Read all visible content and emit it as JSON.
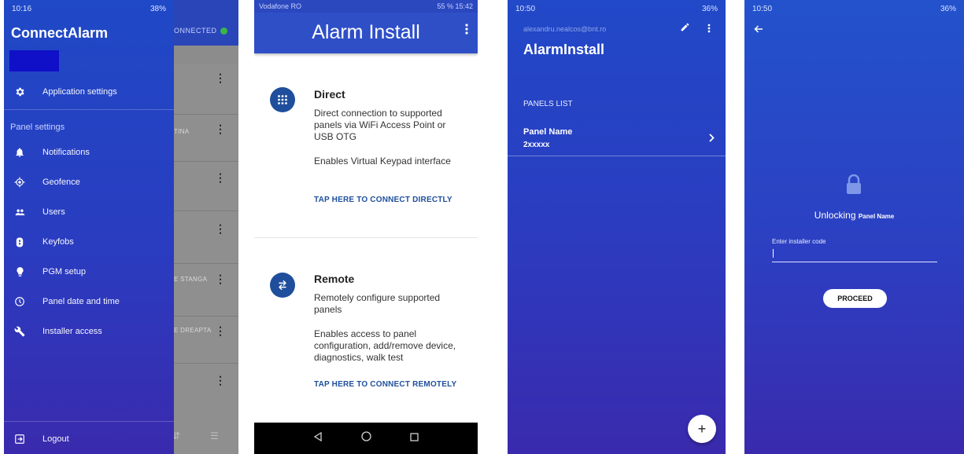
{
  "screen_drawer": {
    "status": {
      "time": "10:16",
      "right": "38%"
    },
    "background": {
      "connected": "ONNECTED",
      "row_texts": [
        "TINA",
        "E STANGA",
        "E DREAPTA"
      ]
    },
    "app_title": "ConnectAlarm",
    "account_color": "#1010c8",
    "menu_top": {
      "label": "Application settings",
      "icon": "gear-icon"
    },
    "section_title": "Panel settings",
    "items": [
      {
        "label": "Notifications",
        "icon": "bell-icon"
      },
      {
        "label": "Geofence",
        "icon": "location-target-icon"
      },
      {
        "label": "Users",
        "icon": "users-icon"
      },
      {
        "label": "Keyfobs",
        "icon": "keyfob-icon"
      },
      {
        "label": "PGM setup",
        "icon": "bulb-icon"
      },
      {
        "label": "Panel date and time",
        "icon": "clock-icon"
      },
      {
        "label": "Installer access",
        "icon": "wrench-icon"
      }
    ],
    "logout": {
      "label": "Logout",
      "icon": "logout-icon"
    }
  },
  "screen_install": {
    "status": {
      "left": "Vodafone RO",
      "right": "55 %  15:42"
    },
    "title": "Alarm Install",
    "direct": {
      "title": "Direct",
      "desc": "Direct connection to supported panels via WiFi Access Point or USB OTG",
      "extra": "Enables Virtual Keypad interface",
      "link": "TAP HERE TO CONNECT DIRECTLY",
      "icon": "dialpad-icon"
    },
    "remote": {
      "title": "Remote",
      "desc": "Remotely configure supported panels",
      "extra": "Enables access to panel configuration, add/remove device, diagnostics, walk test",
      "link": "TAP HERE TO CONNECT REMOTELY",
      "icon": "swap-arrows-icon"
    },
    "accent": "#1f4f9c"
  },
  "screen_panels": {
    "status": {
      "time": "10:50",
      "right": "36%"
    },
    "email": "alexandru.nealcos@bnt.ro",
    "title": "AlarmInstall",
    "list_header": "PANELS LIST",
    "panel": {
      "name": "Panel Name",
      "id": "2xxxxx"
    },
    "fab_label": "+"
  },
  "screen_unlock": {
    "status": {
      "time": "10:50",
      "right": "36%"
    },
    "unlocking": "Unlocking",
    "panel_name": "Panel Name",
    "code_label": "Enter installer code",
    "code_value": "",
    "proceed": "PROCEED"
  }
}
